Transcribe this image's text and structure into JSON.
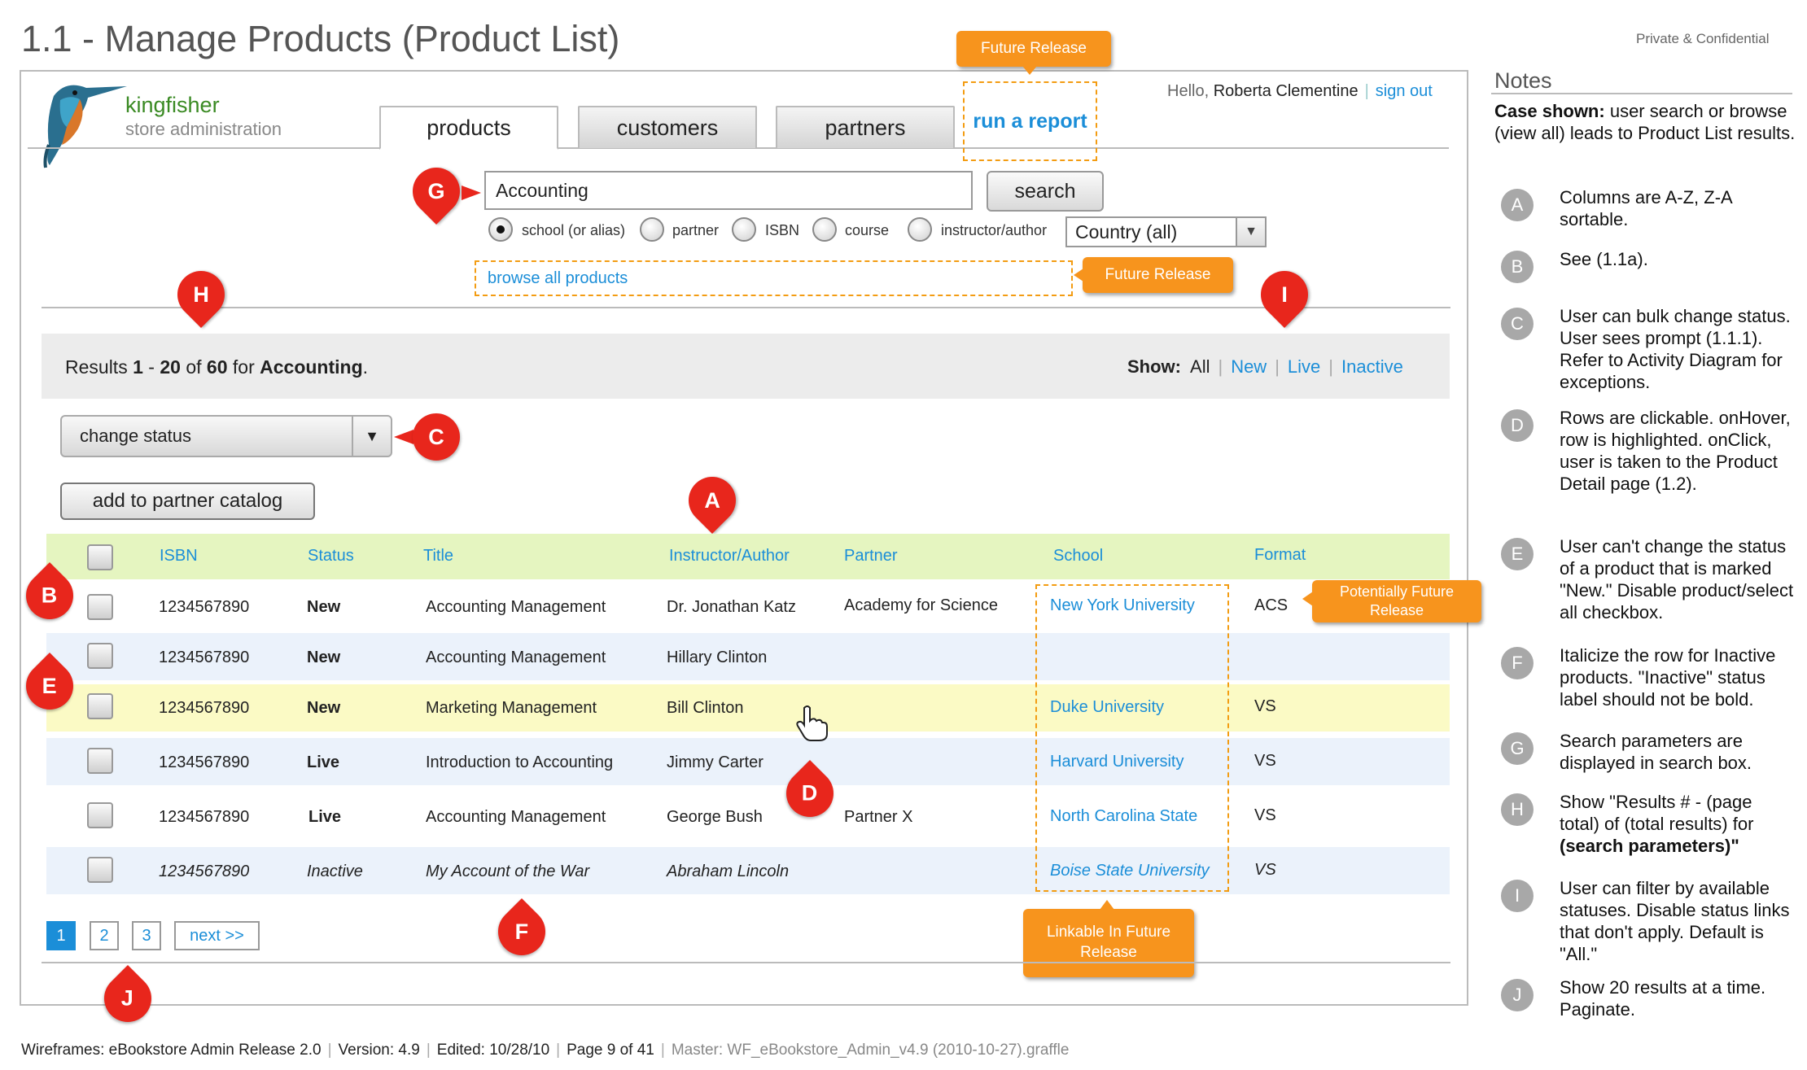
{
  "page": {
    "title": "1.1 - Manage Products (Product List)",
    "confidential": "Private & Confidential"
  },
  "app": {
    "logo_name": "kingfisher",
    "logo_sub": "store administration",
    "greeting": "Hello,",
    "user": "Roberta Clementine",
    "sign_out": "sign out"
  },
  "tabs": [
    {
      "label": "products",
      "active": true
    },
    {
      "label": "customers",
      "active": false
    },
    {
      "label": "partners",
      "active": false
    },
    {
      "label": "run a report",
      "active": false
    }
  ],
  "callouts": {
    "future_release_1": "Future Release",
    "future_release_2": "Future Release",
    "potentially_future": "Potentially Future Release",
    "linkable_future": "Linkable In Future Release"
  },
  "search": {
    "value": "Accounting",
    "button": "search",
    "radios": [
      {
        "label": "school (or alias)",
        "selected": true
      },
      {
        "label": "partner",
        "selected": false
      },
      {
        "label": "ISBN",
        "selected": false
      },
      {
        "label": "course",
        "selected": false
      },
      {
        "label": "instructor/author",
        "selected": false
      }
    ],
    "country": "Country (all)",
    "browse_all": "browse all products"
  },
  "results": {
    "prefix": "Results",
    "from": "1",
    "dash": "-",
    "to": "20",
    "of": "of",
    "total": "60",
    "for": "for",
    "query": "Accounting",
    "period": "."
  },
  "show_filter": {
    "label": "Show:",
    "options": [
      "All",
      "New",
      "Live",
      "Inactive"
    ]
  },
  "controls": {
    "change_status": "change status",
    "add_catalog": "add to partner catalog"
  },
  "table": {
    "headers": [
      "ISBN",
      "Status",
      "Title",
      "Instructor/Author",
      "Partner",
      "School",
      "Format"
    ],
    "rows": [
      {
        "isbn": "1234567890",
        "status": "New",
        "title": "Accounting Management",
        "author": "Dr. Jonathan Katz",
        "partner": "Academy for Science",
        "school": "New York University",
        "format": "ACS"
      },
      {
        "isbn": "1234567890",
        "status": "New",
        "title": "Accounting Management",
        "author": "Hillary Clinton",
        "partner": "",
        "school": "",
        "format": ""
      },
      {
        "isbn": "1234567890",
        "status": "New",
        "title": "Marketing Management",
        "author": "Bill Clinton",
        "partner": "",
        "school": "Duke University",
        "format": "VS"
      },
      {
        "isbn": "1234567890",
        "status": "Live",
        "title": "Introduction to Accounting",
        "author": "Jimmy Carter",
        "partner": "",
        "school": "Harvard University",
        "format": "VS"
      },
      {
        "isbn": "1234567890",
        "status": "Live",
        "title": "Accounting Management",
        "author": "George Bush",
        "partner": "Partner X",
        "school": "North Carolina State",
        "format": "VS"
      },
      {
        "isbn": "1234567890",
        "status": "Inactive",
        "title": "My Account of the War",
        "author": "Abraham Lincoln",
        "partner": "",
        "school": "Boise State University",
        "format": "VS"
      }
    ]
  },
  "pagination": {
    "pages": [
      "1",
      "2",
      "3"
    ],
    "next": "next >>"
  },
  "markers": [
    "A",
    "B",
    "C",
    "D",
    "E",
    "F",
    "G",
    "H",
    "I",
    "J"
  ],
  "notes": {
    "title": "Notes",
    "case_label": "Case shown:",
    "case_text": "user search or browse (view all) leads to Product List results.",
    "items": [
      {
        "letter": "A",
        "text": "Columns are A-Z, Z-A sortable."
      },
      {
        "letter": "B",
        "text": "See (1.1a)."
      },
      {
        "letter": "C",
        "text": "User can bulk change status. User sees prompt (1.1.1). Refer to Activity Diagram for exceptions."
      },
      {
        "letter": "D",
        "text": "Rows are clickable. onHover, row is highlighted. onClick, user is taken to the Product Detail page (1.2)."
      },
      {
        "letter": "E",
        "text": "User can't change the status of a product that is marked \"New.\" Disable product/select all checkbox."
      },
      {
        "letter": "F",
        "text": "Italicize the row for Inactive products. \"Inactive\" status label should not be bold."
      },
      {
        "letter": "G",
        "text": "Search parameters are displayed in search box."
      },
      {
        "letter": "H",
        "text": "Show \"Results # - (page total) of (total results) for",
        "bold": "(search parameters)\""
      },
      {
        "letter": "I",
        "text": "User can filter by available statuses. Disable status links that don't apply. Default is \"All.\""
      },
      {
        "letter": "J",
        "text": "Show 20 results at a time. Paginate."
      }
    ]
  },
  "footer": {
    "wireframes": "Wireframes: eBookstore Admin Release 2.0",
    "version": "Version: 4.9",
    "edited": "Edited:  10/28/10",
    "page": "Page 9 of 41",
    "master": "Master: WF_eBookstore_Admin_v4.9 (2010-10-27).graffle"
  },
  "colors": {
    "link": "#1b8ed8",
    "callout": "#f7941d",
    "marker": "#e8261c",
    "header_row": "#e5f5c0",
    "hover_row": "#fbfac5",
    "alt_row": "#ebf2fb"
  }
}
